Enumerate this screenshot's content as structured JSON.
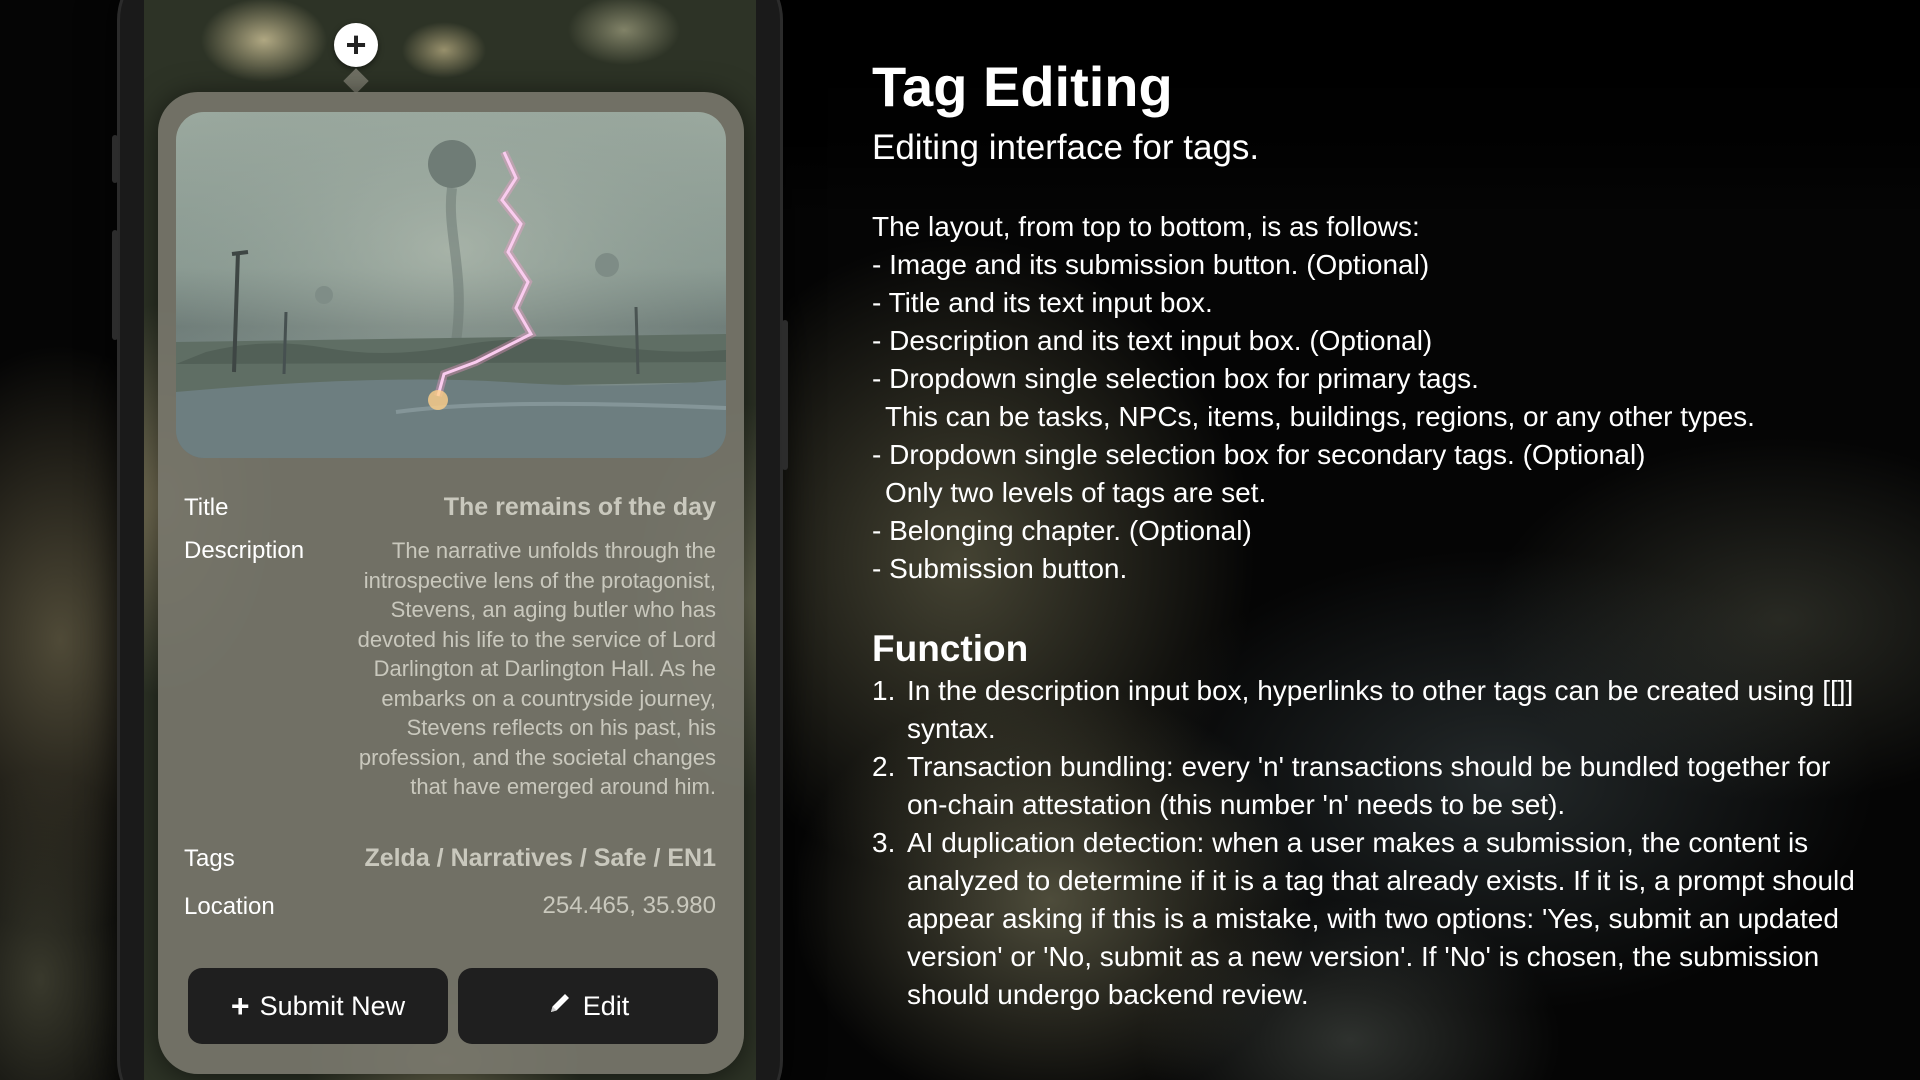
{
  "card": {
    "title_label": "Title",
    "title_value": "The remains of the day",
    "description_label": "Description",
    "description_value": "The narrative unfolds through the introspective lens of the protagonist, Stevens, an aging butler who has devoted his life to the service of Lord Darlington at Darlington Hall. As he embarks on a countryside journey, Stevens reflects on his past, his profession, and the societal changes that have emerged around him.",
    "tags_label": "Tags",
    "tags_value": "Zelda / Narratives / Safe / EN1",
    "location_label": "Location",
    "location_value": "254.465, 35.980",
    "submit_label": "Submit New",
    "edit_label": "Edit",
    "add_icon": "+"
  },
  "panel": {
    "title": "Tag Editing",
    "subtitle": "Editing interface for tags.",
    "layout_intro": "The layout, from top to bottom, is as follows:",
    "layout_items": [
      {
        "text": "- Image and its submission button. (Optional)"
      },
      {
        "text": "- Title and its text input box."
      },
      {
        "text": "- Description and its text input box. (Optional)"
      },
      {
        "text": "- Dropdown single selection box for primary tags.",
        "cont": "This can be tasks, NPCs, items, buildings, regions, or any other types."
      },
      {
        "text": "- Dropdown single selection box for secondary tags. (Optional)",
        "cont": "Only two levels of tags are set."
      },
      {
        "text": "- Belonging chapter. (Optional)"
      },
      {
        "text": "- Submission button."
      }
    ],
    "function_heading": "Function",
    "function_items": [
      {
        "num": "1.",
        "text": "In the description input box, hyperlinks to other tags can be created using [[]] syntax."
      },
      {
        "num": "2.",
        "text": "Transaction bundling: every 'n' transactions should be bundled together for on-chain attestation (this number 'n' needs to be set)."
      },
      {
        "num": "3.",
        "text": "AI duplication detection: when a user makes a submission, the content is analyzed to determine if it is a tag that already exists. If it is, a prompt should appear asking if this is a mistake, with two options: 'Yes, submit an updated version' or 'No, submit as a new version'. If 'No' is chosen, the submission should undergo backend review."
      }
    ]
  }
}
